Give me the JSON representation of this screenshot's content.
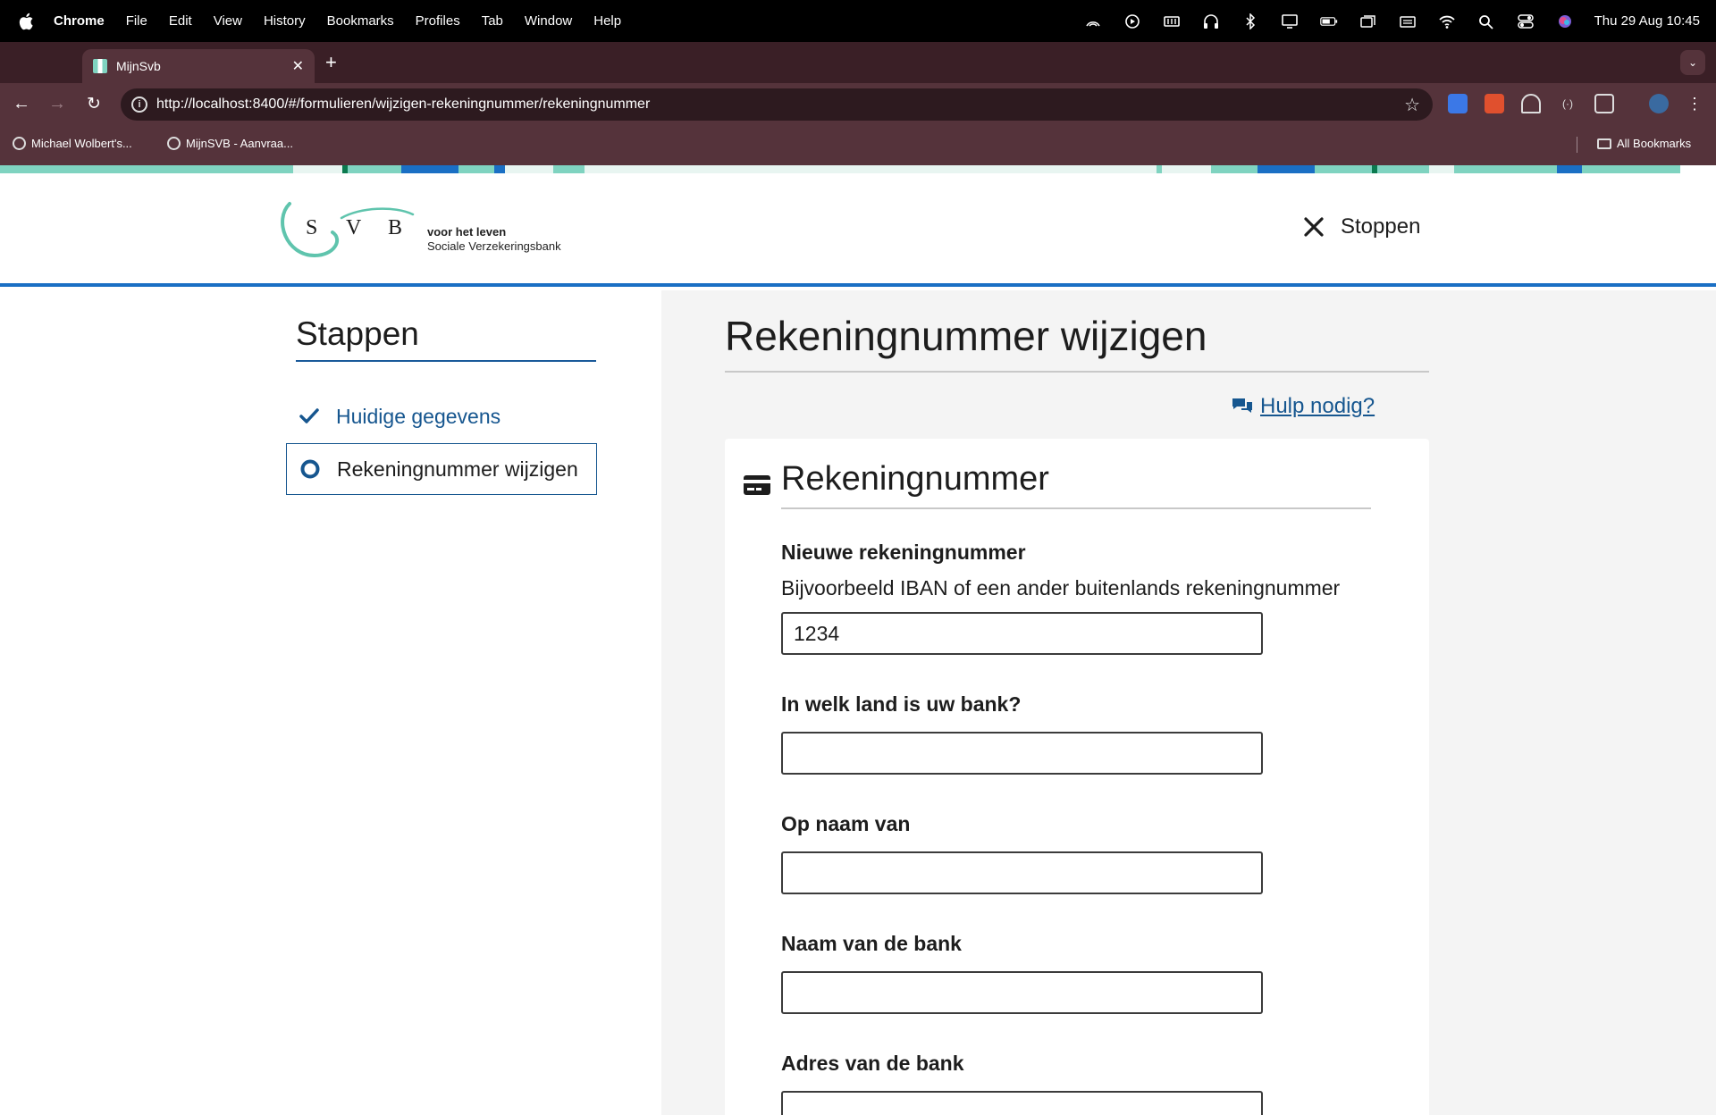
{
  "menubar": {
    "app_name": "Chrome",
    "items": [
      "File",
      "Edit",
      "View",
      "History",
      "Bookmarks",
      "Profiles",
      "Tab",
      "Window",
      "Help"
    ],
    "clock": "Thu 29 Aug  10:45"
  },
  "browser": {
    "tab_title": "MijnSvb",
    "url": "http://localhost:8400/#/formulieren/wijzigen-rekeningnummer/rekeningnummer",
    "bookmarks": [
      "Michael Wolbert's...",
      "MijnSVB - Aanvraa..."
    ],
    "all_bookmarks": "All Bookmarks"
  },
  "header": {
    "logo_letters": [
      "S",
      "V",
      "B"
    ],
    "tagline_1": "voor het leven",
    "tagline_2": "Sociale Verzekeringsbank",
    "stop_label": "Stoppen"
  },
  "sidebar": {
    "title": "Stappen",
    "steps": [
      {
        "label": "Huidige gegevens",
        "state": "done"
      },
      {
        "label": "Rekeningnummer wijzigen",
        "state": "current"
      }
    ]
  },
  "main": {
    "title": "Rekeningnummer wijzigen",
    "help_label": "Hulp nodig?",
    "card_title": "Rekeningnummer",
    "fields": [
      {
        "label": "Nieuwe rekeningnummer",
        "hint": "Bijvoorbeeld IBAN of een ander buitenlands rekeningnummer",
        "value": "1234"
      },
      {
        "label": "In welk land is uw bank?",
        "value": ""
      },
      {
        "label": "Op naam van",
        "value": ""
      },
      {
        "label": "Naam van de bank",
        "value": ""
      },
      {
        "label": "Adres van de bank",
        "value": ""
      }
    ]
  },
  "colors": {
    "brand_blue": "#16568f",
    "accent_teal": "#7fd3c0",
    "header_rule": "#1a6fc4"
  }
}
